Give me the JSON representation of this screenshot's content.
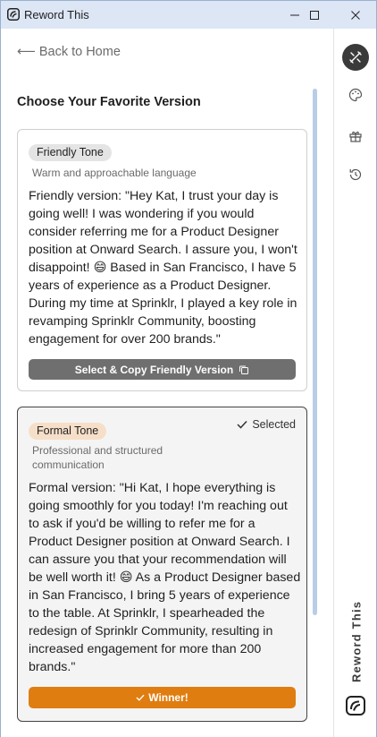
{
  "window": {
    "title": "Reword This",
    "icons": [
      "app-logo-icon",
      "minimize-icon",
      "maximize-icon",
      "close-icon"
    ]
  },
  "nav": {
    "back_label": "Back to Home",
    "back_arrow": "⟵"
  },
  "page": {
    "heading": "Choose Your Favorite Version"
  },
  "cards": [
    {
      "tag": "Friendly Tone",
      "description": "Warm and approachable language",
      "text": "Friendly version: \"Hey Kat, I trust your day is going well! I was wondering if you would consider referring me for a Product Designer position at Onward Search. I assure you, I won't disappoint! 😄 Based in San Francisco, I have 5 years of experience as a Product Designer. During my time at Sprinklr, I played a key role in revamping Sprinklr Community, boosting engagement for over 200 brands.\"",
      "action_label": "Select & Copy Friendly Version",
      "action_icon": "copy-icon"
    },
    {
      "tag": "Formal Tone",
      "description": "Professional and structured communication",
      "selected_label": "Selected",
      "text": "Formal version: \"Hi Kat, I hope everything is going smoothly for you today! I'm reaching out to ask if you'd be willing to refer me for a Product Designer position at Onward Search. I can assure you that your recommendation will be well worth it! 😄 As a Product Designer based in San Francisco, I bring 5 years of experience to the table. At Sprinklr, I spearheaded the redesign of Sprinklr Community, resulting in increased engagement for more than 200 brands.\"",
      "action_label": "Winner!",
      "action_icon": "check-icon"
    }
  ],
  "rail": {
    "buttons": [
      "tools-icon",
      "palette-icon",
      "gift-icon",
      "history-icon"
    ],
    "brand_label": "Reword This"
  },
  "colors": {
    "titlebar": "#dde6f5",
    "accent_orange": "#e07d10",
    "grey_button": "#6f6f6f",
    "scroll_thumb": "#b8cde6"
  }
}
